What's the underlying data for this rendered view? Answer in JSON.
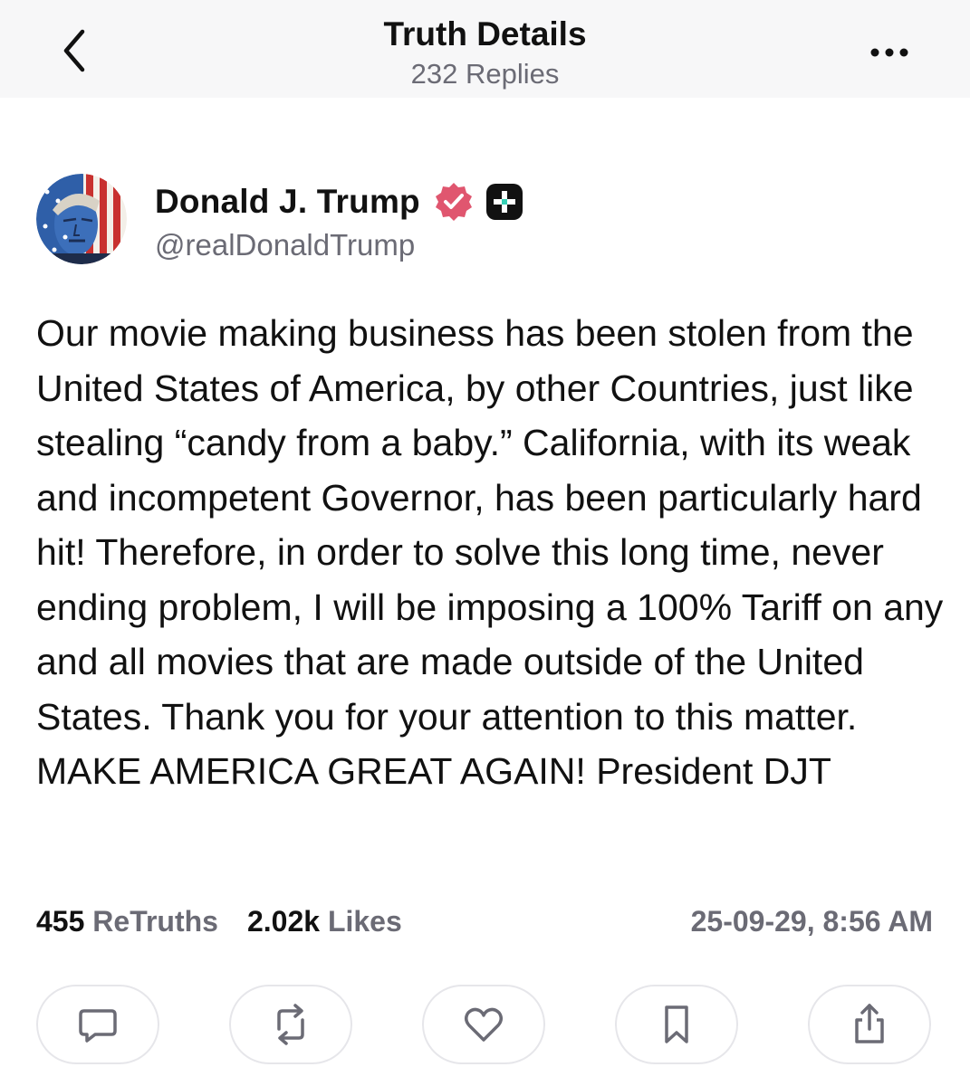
{
  "header": {
    "title": "Truth Details",
    "subtitle": "232 Replies",
    "back_icon": "chevron-left-icon",
    "more_icon": "more-horizontal-icon"
  },
  "post": {
    "author": {
      "display_name": "Donald J. Trump",
      "handle": "@realDonaldTrump",
      "verified_badge_color": "#e0566f",
      "plus_badge_color": "#111111"
    },
    "text": "Our movie making business has been stolen from the United States of America, by other Countries, just like stealing “candy from a baby.” California, with its weak and incompetent Governor, has been particularly hard hit! Therefore, in order to solve this long time, never ending problem, I will be imposing a 100% Tariff on any and all movies that are made outside of the United States. Thank you for your attention to this matter. MAKE AMERICA GREAT AGAIN! President DJT",
    "stats": {
      "retruths_count": "455",
      "retruths_label": "ReTruths",
      "likes_count": "2.02k",
      "likes_label": "Likes"
    },
    "timestamp": "25-09-29, 8:56 AM"
  },
  "actions": [
    {
      "name": "reply",
      "icon": "comment-icon"
    },
    {
      "name": "retruth",
      "icon": "repost-icon"
    },
    {
      "name": "like",
      "icon": "heart-icon"
    },
    {
      "name": "bookmark",
      "icon": "bookmark-icon"
    },
    {
      "name": "share",
      "icon": "share-icon"
    }
  ],
  "colors": {
    "text_primary": "#111111",
    "text_secondary": "#6b6b75",
    "header_bg": "#f7f7f8",
    "button_border": "#e6e6ea",
    "icon_color": "#6b6b75"
  }
}
